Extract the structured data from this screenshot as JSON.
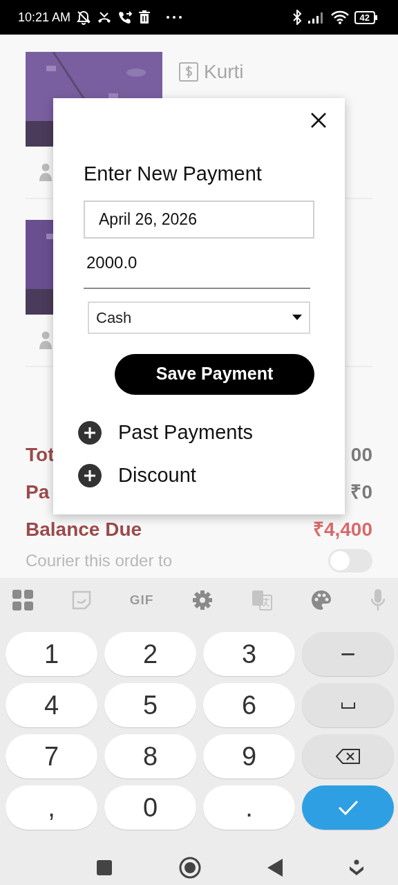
{
  "status_bar": {
    "time": "10:21 AM",
    "battery": "42"
  },
  "order": {
    "items": [
      {
        "title": "Kurti",
        "kind": "picture"
      },
      {
        "kind": "picture"
      }
    ],
    "totals": [
      {
        "label": "Tot",
        "value": "00",
        "color": "#7a7a7a"
      },
      {
        "label": "Pa",
        "value": "₹0",
        "color": "#7a7a7a"
      },
      {
        "label": "Balance Due",
        "value": "₹4,400",
        "color": "#d86a6a"
      }
    ],
    "courier": {
      "label": "Courier this order to",
      "on": false
    }
  },
  "dialog": {
    "title": "Enter New Payment",
    "date": "April 26, 2026",
    "amount": "2000.0",
    "method": "Cash",
    "save_button": "Save Payment",
    "sections": [
      {
        "label": "Past Payments",
        "expanded": false
      },
      {
        "label": "Discount",
        "expanded": false
      }
    ]
  },
  "keyboard": {
    "toolbar": [
      {
        "kind": "apps"
      },
      {
        "kind": "sticker"
      },
      {
        "kind": "gif",
        "label": "GIF"
      },
      {
        "kind": "settings"
      },
      {
        "kind": "translate"
      },
      {
        "kind": "theme"
      },
      {
        "kind": "mic"
      }
    ],
    "keys": [
      {
        "kind": "char",
        "label": "1"
      },
      {
        "kind": "char",
        "label": "2"
      },
      {
        "kind": "char",
        "label": "3"
      },
      {
        "kind": "func",
        "label": "−"
      },
      {
        "kind": "char",
        "label": "4"
      },
      {
        "kind": "char",
        "label": "5"
      },
      {
        "kind": "char",
        "label": "6"
      },
      {
        "kind": "space"
      },
      {
        "kind": "char",
        "label": "7"
      },
      {
        "kind": "char",
        "label": "8"
      },
      {
        "kind": "char",
        "label": "9"
      },
      {
        "kind": "backspace"
      },
      {
        "kind": "char",
        "label": ","
      },
      {
        "kind": "char",
        "label": "0"
      },
      {
        "kind": "char",
        "label": "."
      },
      {
        "kind": "enter"
      }
    ]
  }
}
